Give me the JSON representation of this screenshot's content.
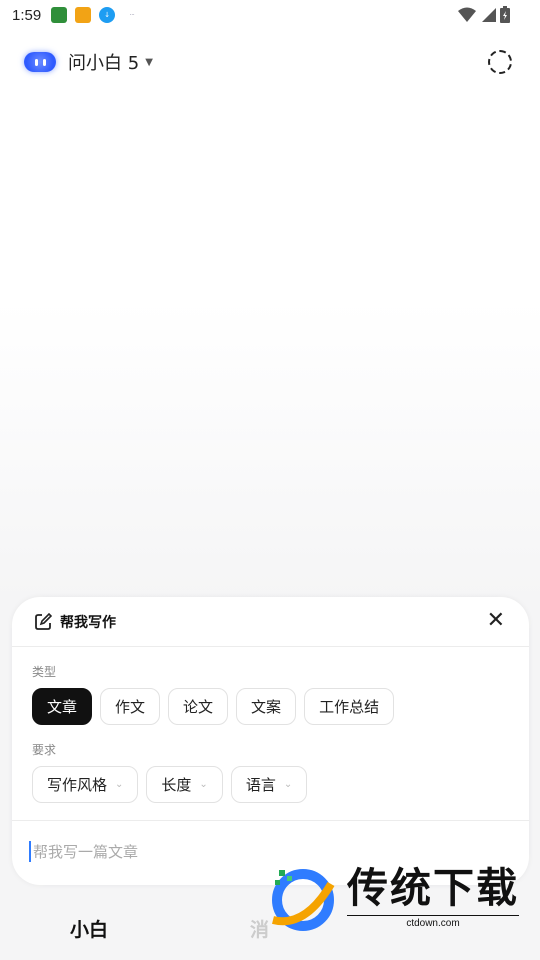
{
  "status_bar": {
    "time": "1:59",
    "notifications": [
      "app-notif-green",
      "app-notif-orange",
      "download-icon",
      "app-notif-small"
    ]
  },
  "header": {
    "model_name": "问小白 5"
  },
  "panel": {
    "title": "帮我写作",
    "type_label": "类型",
    "type_chips": [
      "文章",
      "作文",
      "论文",
      "文案",
      "工作总结"
    ],
    "selected_type": "文章",
    "req_label": "要求",
    "req_chips": [
      "写作风格",
      "长度",
      "语言"
    ],
    "input_placeholder": "帮我写一篇文章"
  },
  "bottom_nav": {
    "tab1": "小白",
    "tab2": "消"
  },
  "watermark": {
    "title": "传统下载",
    "sub": "ctdown.com"
  }
}
